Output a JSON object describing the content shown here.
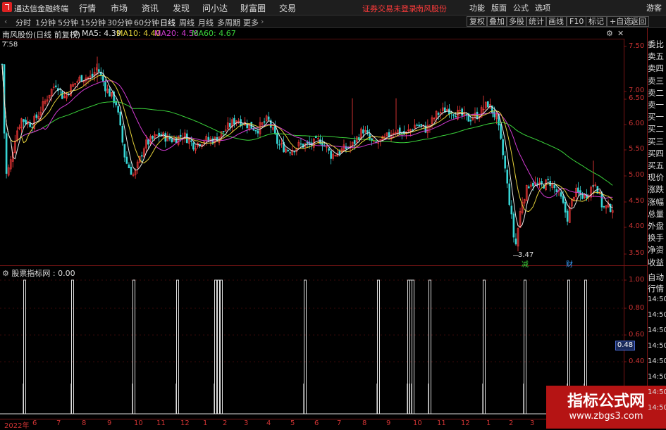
{
  "titlebar": {
    "app_title": "通达信金融终端",
    "menus": [
      "行情",
      "市场",
      "资讯",
      "发现",
      "问小达",
      "财富圈",
      "交易"
    ],
    "warning": "证券交易未登录",
    "stock_name": "南风股份",
    "tools": [
      "功能",
      "版面",
      "公式",
      "选项"
    ],
    "guest": "游客"
  },
  "toolbar": {
    "periods": [
      "分时",
      "1分钟",
      "5分钟",
      "15分钟",
      "30分钟",
      "60分钟",
      "日线",
      "周线",
      "月线",
      "多周期",
      "更多"
    ],
    "active_period": "日线",
    "right_buttons": [
      "复权",
      "叠加",
      "多股",
      "统计",
      "画线",
      "F10",
      "标记",
      "+自选",
      "返回"
    ]
  },
  "legend": {
    "stock_label": "南风股份(日线 前复权)",
    "ma5": "MA5: 4.39",
    "ma10": "MA10: 4.40",
    "ma20": "MA20: 4.58",
    "ma60": "MA60: 4.67",
    "high_marker": "7.58",
    "low_marker": "3.47",
    "event_mark_1": "减",
    "event_mark_2": "财"
  },
  "colors": {
    "ma5": "#e8e8e8",
    "ma10": "#e6d23a",
    "ma20": "#d23ad2",
    "ma60": "#3ad23a",
    "up": "#ff3b3b",
    "down": "#37d6d6",
    "axis_red": "#c33",
    "watermark_bg": "#b51414"
  },
  "price_axis": {
    "labels": [
      "7.50",
      "7.00",
      "6.50",
      "6.00",
      "5.50",
      "5.00",
      "4.50",
      "4.00",
      "3.50"
    ]
  },
  "indicator": {
    "label": "股票指标网 : 0.00",
    "axis_labels": [
      "1.00",
      "0.80",
      "0.60",
      "0.40"
    ],
    "current_value": "0.48",
    "spikes": [
      35,
      103,
      190,
      252,
      306,
      310,
      314,
      433,
      537,
      580,
      583,
      586,
      610,
      687,
      745,
      807,
      831
    ]
  },
  "right_panel": {
    "items": [
      "委比",
      "卖五",
      "卖四",
      "卖三",
      "卖二",
      "卖一",
      "买一",
      "买二",
      "买三",
      "买四",
      "买五",
      "现价",
      "涨跌",
      "涨幅",
      "总量",
      "外盘",
      "换手",
      "净资",
      "收益"
    ],
    "auto": "自动",
    "market": "行情",
    "times": [
      "14:50",
      "14:50",
      "14:50",
      "14:50",
      "14:50",
      "14:50",
      "14:50",
      "14:50"
    ]
  },
  "x_axis": {
    "labels": [
      "2022年",
      "6",
      "7",
      "8",
      "9",
      "10",
      "11",
      "12",
      "1",
      "2",
      "3",
      "4",
      "5",
      "6",
      "7",
      "8",
      "9",
      "10",
      "11",
      "12",
      "1",
      "2",
      "3"
    ]
  },
  "watermark": {
    "title": "指标公式网",
    "url": "www.zbgs3.com"
  }
}
